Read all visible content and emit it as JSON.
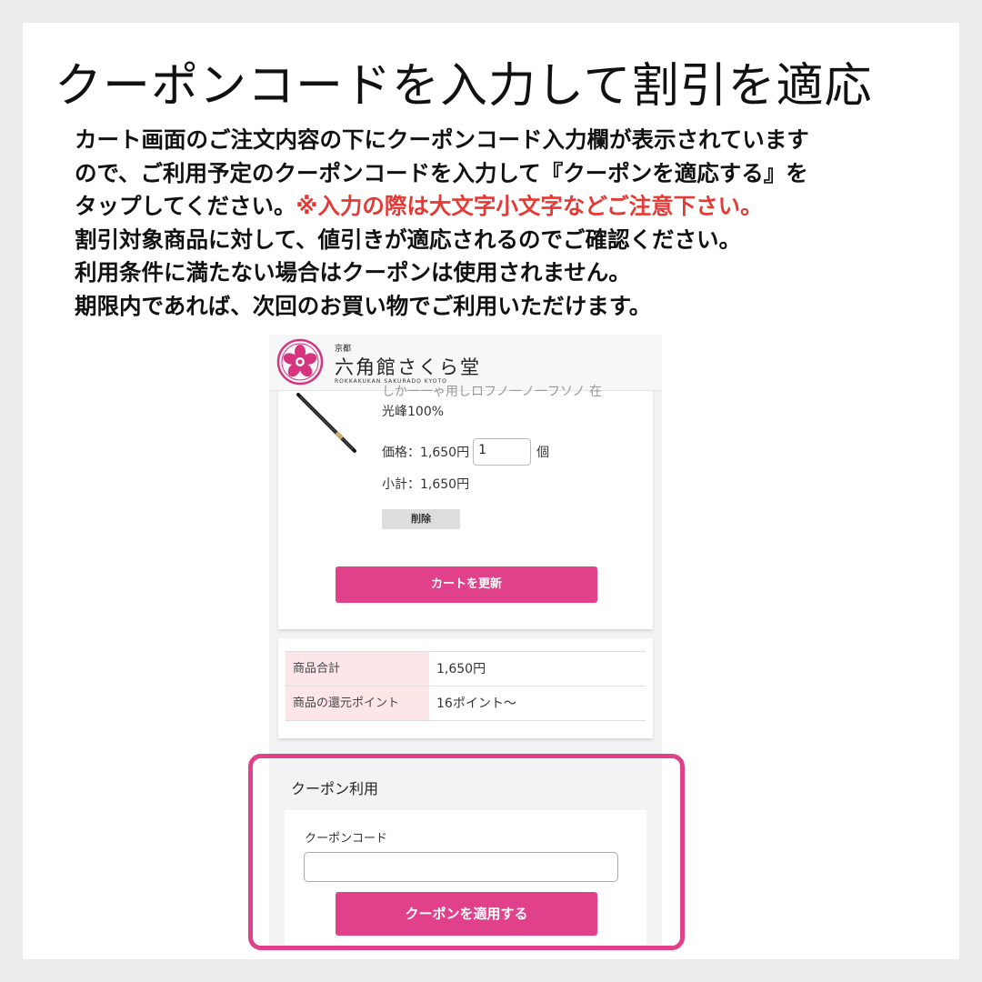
{
  "headline": "クーポンコードを入力して割引を適応",
  "intro": {
    "line1": "カート画面のご注文内容の下にクーポンコード入力欄が表示されています",
    "line2": "ので、ご利用予定のクーポンコードを入力して『クーポンを適応する』を",
    "line3_a": "タップしてください。",
    "line3_warn": "※入力の際は大文字小文字などご注意下さい。",
    "line4": "割引対象商品に対して、値引きが適応されるのでご確認ください。",
    "line5": "利用条件に満たない場合はクーポンは使用されません。",
    "line6": "期限内であれば、次回のお買い物でご利用いただけます。"
  },
  "colors": {
    "accent": "#e0418a",
    "warning": "#e53935",
    "table_key_bg": "#fde6e8"
  },
  "shop": {
    "sub": "京都",
    "name": "六角館さくら堂",
    "roman": "ROKKAKUKAN SAKURADO KYOTO",
    "logo_icon": "sakura-crest-icon"
  },
  "cart_item": {
    "name_cut": "しか一一ゃ用しロフノ一ノ一フソノ 在",
    "name": "光峰100%",
    "price_label": "価格：1,650円",
    "qty": "1",
    "unit": "個",
    "subtotal": "小計：1,650円",
    "delete_label": "削除",
    "update_label": "カートを更新"
  },
  "summary": [
    {
      "key": "商品合計",
      "value": "1,650円"
    },
    {
      "key": "商品の還元ポイント",
      "value": "16ポイント～"
    }
  ],
  "coupon": {
    "title": "クーポン利用",
    "field_label": "クーポンコード",
    "field_value": "",
    "apply_label": "クーポンを適用する"
  }
}
